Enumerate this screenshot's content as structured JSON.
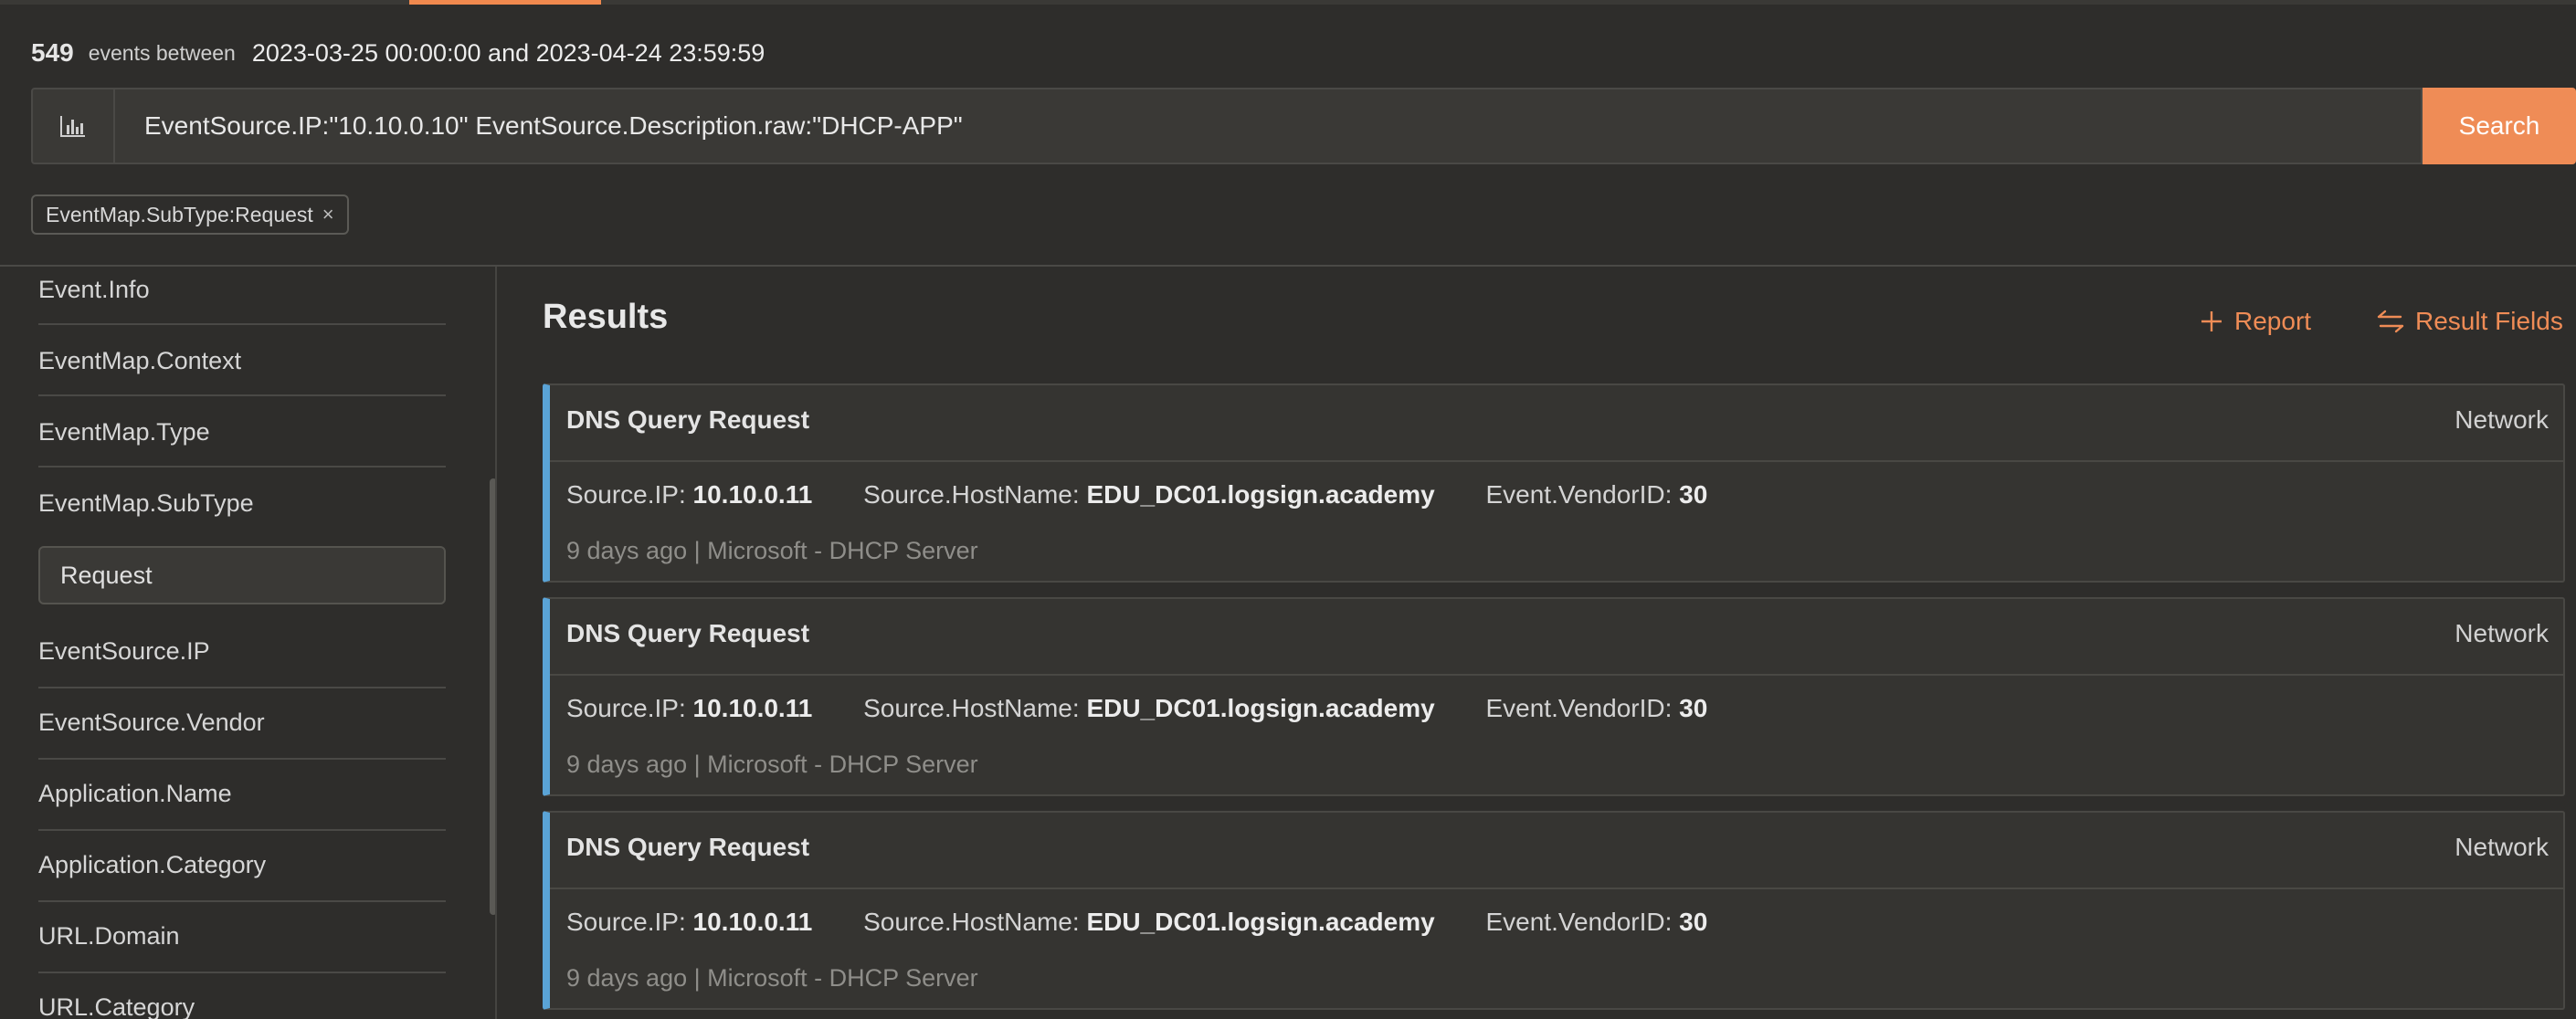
{
  "summary": {
    "count": "549",
    "between_label": "events between",
    "range": "2023-03-25 00:00:00 and 2023-04-24 23:59:59"
  },
  "search": {
    "query": "EventSource.IP:\"10.10.0.10\" EventSource.Description.raw:\"DHCP-APP\"",
    "button_label": "Search",
    "chart_icon": "bar-chart-icon"
  },
  "filters": [
    {
      "label": "EventMap.SubType:Request",
      "close_glyph": "×"
    }
  ],
  "sidebar": {
    "items": [
      "Event.Info",
      "EventMap.Context",
      "EventMap.Type",
      "EventMap.SubType",
      "EventSource.IP",
      "EventSource.Vendor",
      "Application.Name",
      "Application.Category",
      "URL.Domain",
      "URL.Category"
    ],
    "subtype_value": "Request"
  },
  "results": {
    "title": "Results",
    "report_label": "Report",
    "fields_label": "Result Fields",
    "cards": [
      {
        "title": "DNS Query Request",
        "category": "Network",
        "k1": "Source.IP:",
        "v1": "10.10.0.11",
        "k2": "Source.HostName:",
        "v2": "EDU_DC01.logsign.academy",
        "k3": "Event.VendorID:",
        "v3": "30",
        "meta": "9 days ago | Microsoft - DHCP Server"
      },
      {
        "title": "DNS Query Request",
        "category": "Network",
        "k1": "Source.IP:",
        "v1": "10.10.0.11",
        "k2": "Source.HostName:",
        "v2": "EDU_DC01.logsign.academy",
        "k3": "Event.VendorID:",
        "v3": "30",
        "meta": "9 days ago | Microsoft - DHCP Server"
      },
      {
        "title": "DNS Query Request",
        "category": "Network",
        "k1": "Source.IP:",
        "v1": "10.10.0.11",
        "k2": "Source.HostName:",
        "v2": "EDU_DC01.logsign.academy",
        "k3": "Event.VendorID:",
        "v3": "30",
        "meta": "9 days ago | Microsoft - DHCP Server"
      }
    ]
  },
  "colors": {
    "background": "#2e2d2b",
    "accent": "#ef8c56",
    "card_border_left": "#5aa3d6"
  }
}
